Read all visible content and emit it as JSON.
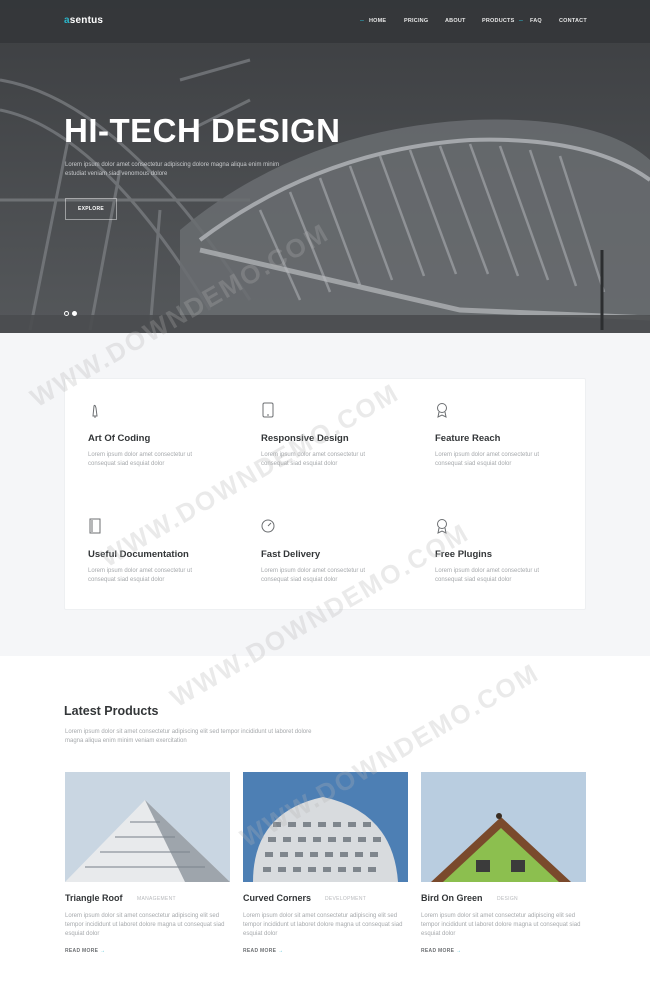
{
  "nav": {
    "logo_dot": "a",
    "logo_text": "sentus",
    "items": [
      "HOME",
      "PRICING",
      "ABOUT",
      "PRODUCTS",
      "FAQ",
      "CONTACT"
    ]
  },
  "hero": {
    "title": "HI-TECH DESIGN",
    "text": "Lorem ipsum dolor amet consectetur adipiscing dolore magna aliqua enim minim estudiat veniam siad venomous dolore",
    "button": "EXPLORE",
    "slide_count": 2,
    "active_slide": 2
  },
  "features": [
    {
      "icon": "pen-icon",
      "title": "Art Of Coding",
      "text": "Lorem ipsum dolor amet consectetur ut consequat siad esquiat dolor"
    },
    {
      "icon": "tablet-icon",
      "title": "Responsive Design",
      "text": "Lorem ipsum dolor amet consectetur ut consequat siad esquiat dolor"
    },
    {
      "icon": "badge-icon",
      "title": "Feature Reach",
      "text": "Lorem ipsum dolor amet consectetur ut consequat siad esquiat dolor"
    },
    {
      "icon": "document-icon",
      "title": "Useful Documentation",
      "text": "Lorem ipsum dolor amet consectetur ut consequat siad esquiat dolor"
    },
    {
      "icon": "speedometer-icon",
      "title": "Fast Delivery",
      "text": "Lorem ipsum dolor amet consectetur ut consequat siad esquiat dolor"
    },
    {
      "icon": "badge-icon",
      "title": "Free Plugins",
      "text": "Lorem ipsum dolor amet consectetur ut consequat siad esquiat dolor"
    }
  ],
  "products_section": {
    "title": "Latest Products",
    "text": "Lorem ipsum dolor sit amet consectetur adipiscing elit sed tempor incididunt ut laboret dolore magna aliqua enim minim veniam exercitation"
  },
  "products": [
    {
      "title": "Triangle Roof",
      "tag": "MANAGEMENT",
      "text": "Lorem ipsum dolor sit amet consectetur adipiscing elit sed tempor incididunt ut laboret dolore magna ut consequat siad esquiat dolor",
      "link": "READ MORE"
    },
    {
      "title": "Curved Corners",
      "tag": "DEVELOPMENT",
      "text": "Lorem ipsum dolor sit amet consectetur adipiscing elit sed tempor incididunt ut laboret dolore magna ut consequat siad esquiat dolor",
      "link": "READ MORE"
    },
    {
      "title": "Bird On Green",
      "tag": "DESIGN",
      "text": "Lorem ipsum dolor sit amet consectetur adipiscing elit sed tempor incididunt ut laboret dolore magna ut consequat siad esquiat dolor",
      "link": "READ MORE"
    }
  ],
  "watermark": "WWW.DOWNDEMO.COM",
  "colors": {
    "accent": "#2bb5c9",
    "dark": "#333638",
    "muted": "#a6a9ac"
  }
}
